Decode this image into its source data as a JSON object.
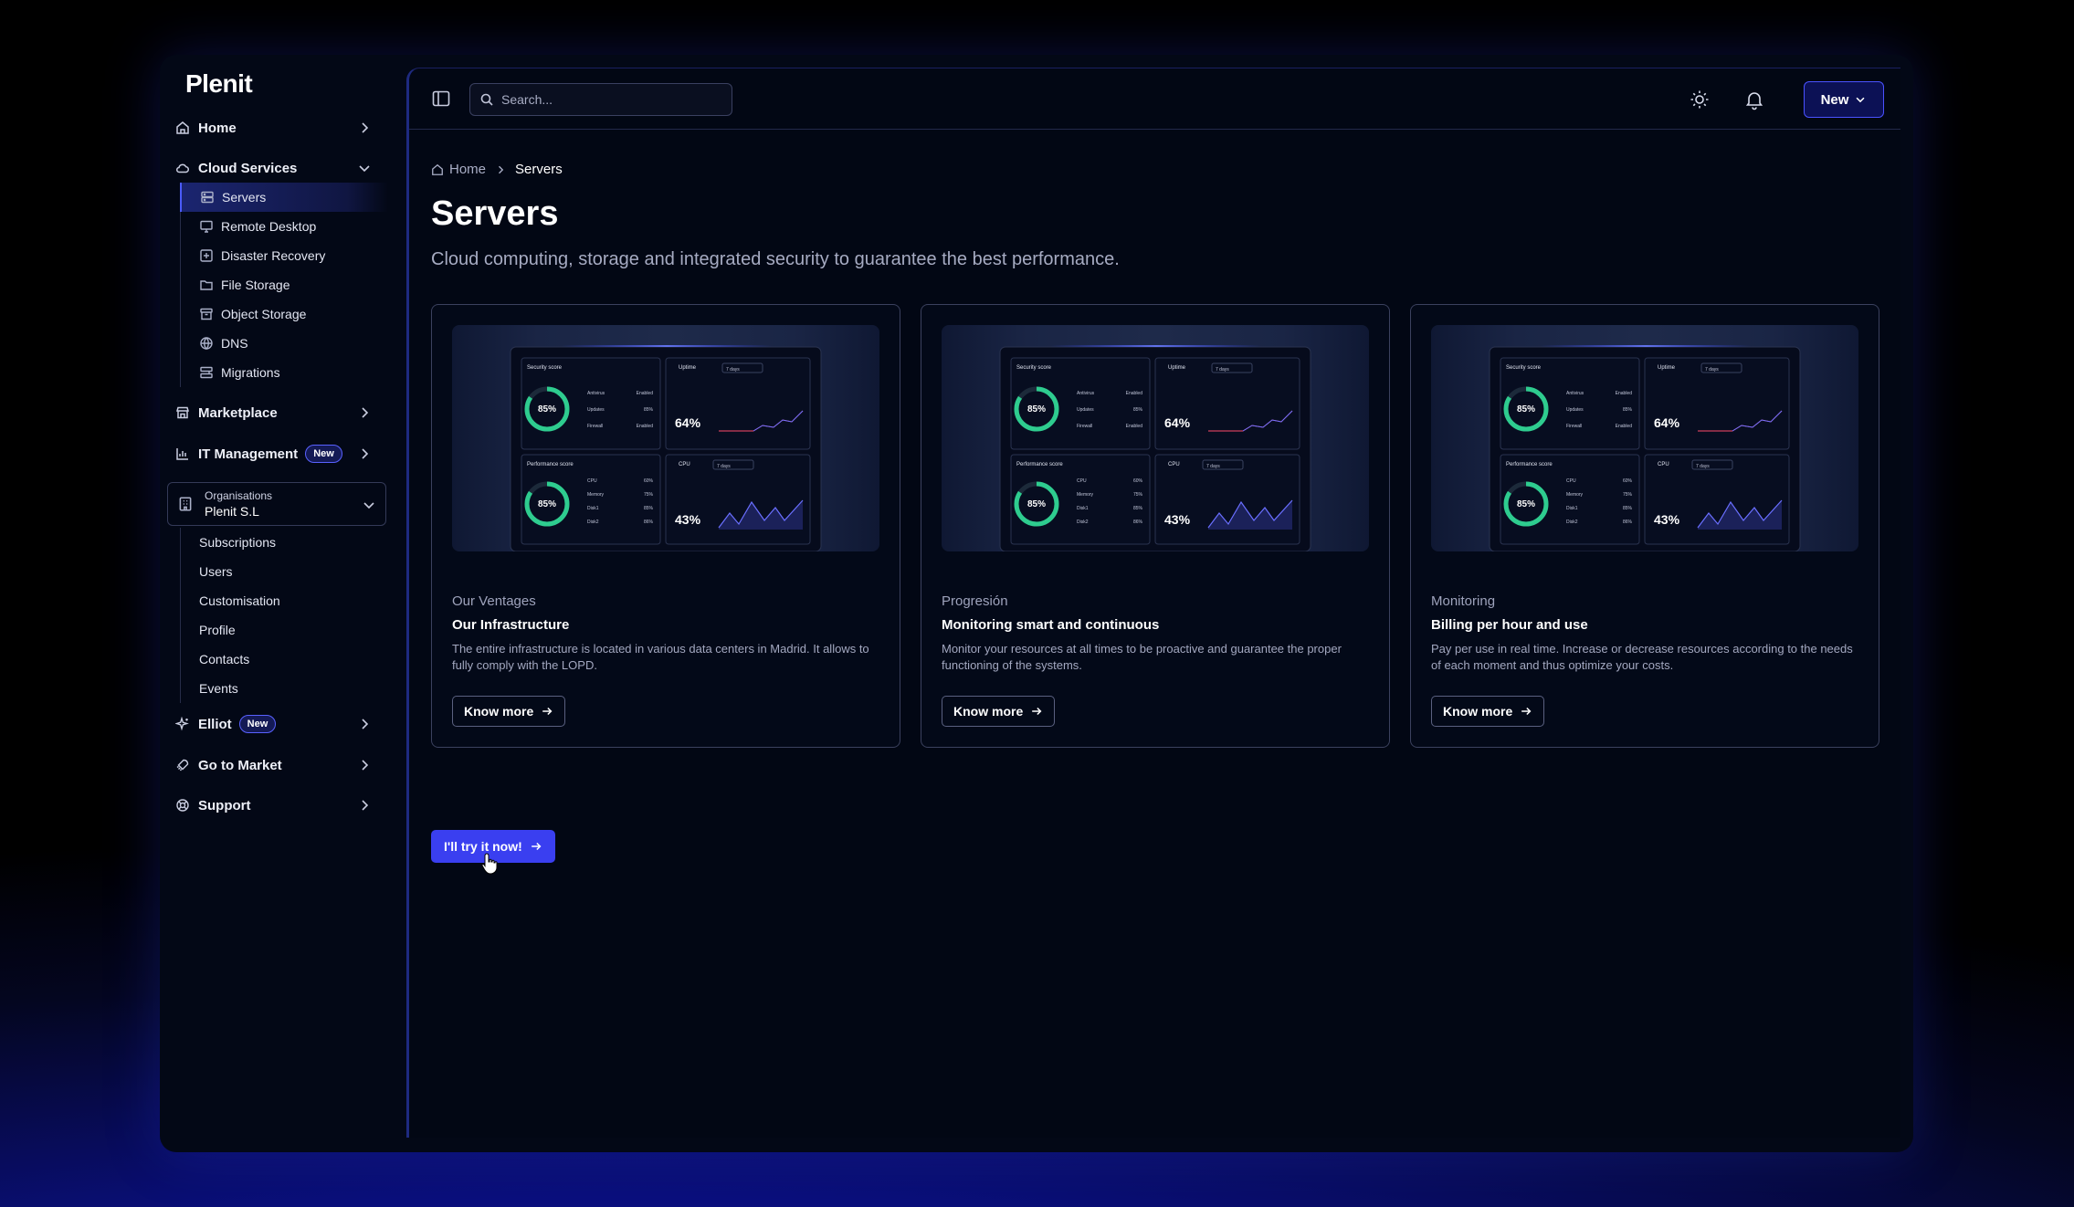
{
  "app": {
    "logo": "Plenit"
  },
  "sidebar": {
    "home": "Home",
    "cloud_services": "Cloud Services",
    "cloud_items": [
      {
        "label": "Servers",
        "icon": "server-icon"
      },
      {
        "label": "Remote Desktop",
        "icon": "monitor-icon"
      },
      {
        "label": "Disaster Recovery",
        "icon": "recovery-icon"
      },
      {
        "label": "File Storage",
        "icon": "folder-icon"
      },
      {
        "label": "Object Storage",
        "icon": "archive-icon"
      },
      {
        "label": "DNS",
        "icon": "globe-icon"
      },
      {
        "label": "Migrations",
        "icon": "migrate-icon"
      }
    ],
    "marketplace": "Marketplace",
    "it_management": "IT Management",
    "it_badge": "New",
    "org_label": "Organisations",
    "org_name": "Plenit S.L",
    "org_items": [
      "Subscriptions",
      "Users",
      "Customisation",
      "Profile",
      "Contacts",
      "Events"
    ],
    "elliot": "Elliot",
    "elliot_badge": "New",
    "go_to_market": "Go to Market",
    "support": "Support"
  },
  "topbar": {
    "search_placeholder": "Search...",
    "new_label": "New"
  },
  "breadcrumb": {
    "home": "Home",
    "current": "Servers"
  },
  "page": {
    "title": "Servers",
    "description": "Cloud computing, storage and integrated security to guarantee the best performance."
  },
  "preview": {
    "security_title": "Security score",
    "security_value": "85%",
    "security_rows": [
      [
        "Antivirus",
        "Enabled"
      ],
      [
        "Updates",
        "85%"
      ],
      [
        "Firewall",
        "Enabled"
      ]
    ],
    "uptime_label": "Uptime",
    "uptime_value": "64%",
    "range_label": "7 days",
    "performance_title": "Performance score",
    "performance_value": "85%",
    "performance_rows": [
      [
        "CPU",
        "60%"
      ],
      [
        "Memory",
        "75%"
      ],
      [
        "Disk1",
        "85%"
      ],
      [
        "Disk2",
        "86%"
      ]
    ],
    "cpu_label": "CPU",
    "cpu_value": "43%"
  },
  "cards": [
    {
      "kicker": "Our Ventages",
      "title": "Our Infrastructure",
      "description": "The entire infrastructure is located in various data centers in Madrid. It allows to fully comply with the LOPD.",
      "button": "Know more"
    },
    {
      "kicker": "Progresión",
      "title": "Monitoring smart and continuous",
      "description": "Monitor your resources at all times to be proactive and guarantee the proper functioning of the systems.",
      "button": "Know more"
    },
    {
      "kicker": "Monitoring",
      "title": "Billing per hour and use",
      "description": "Pay per use in real time. Increase or decrease resources according to the needs of each moment and thus optimize your costs.",
      "button": "Know more"
    }
  ],
  "cta": {
    "label": "I'll try it now!"
  },
  "colors": {
    "accent": "#3a3ff0",
    "accent_border": "#4a52ff",
    "background": "#020714"
  }
}
